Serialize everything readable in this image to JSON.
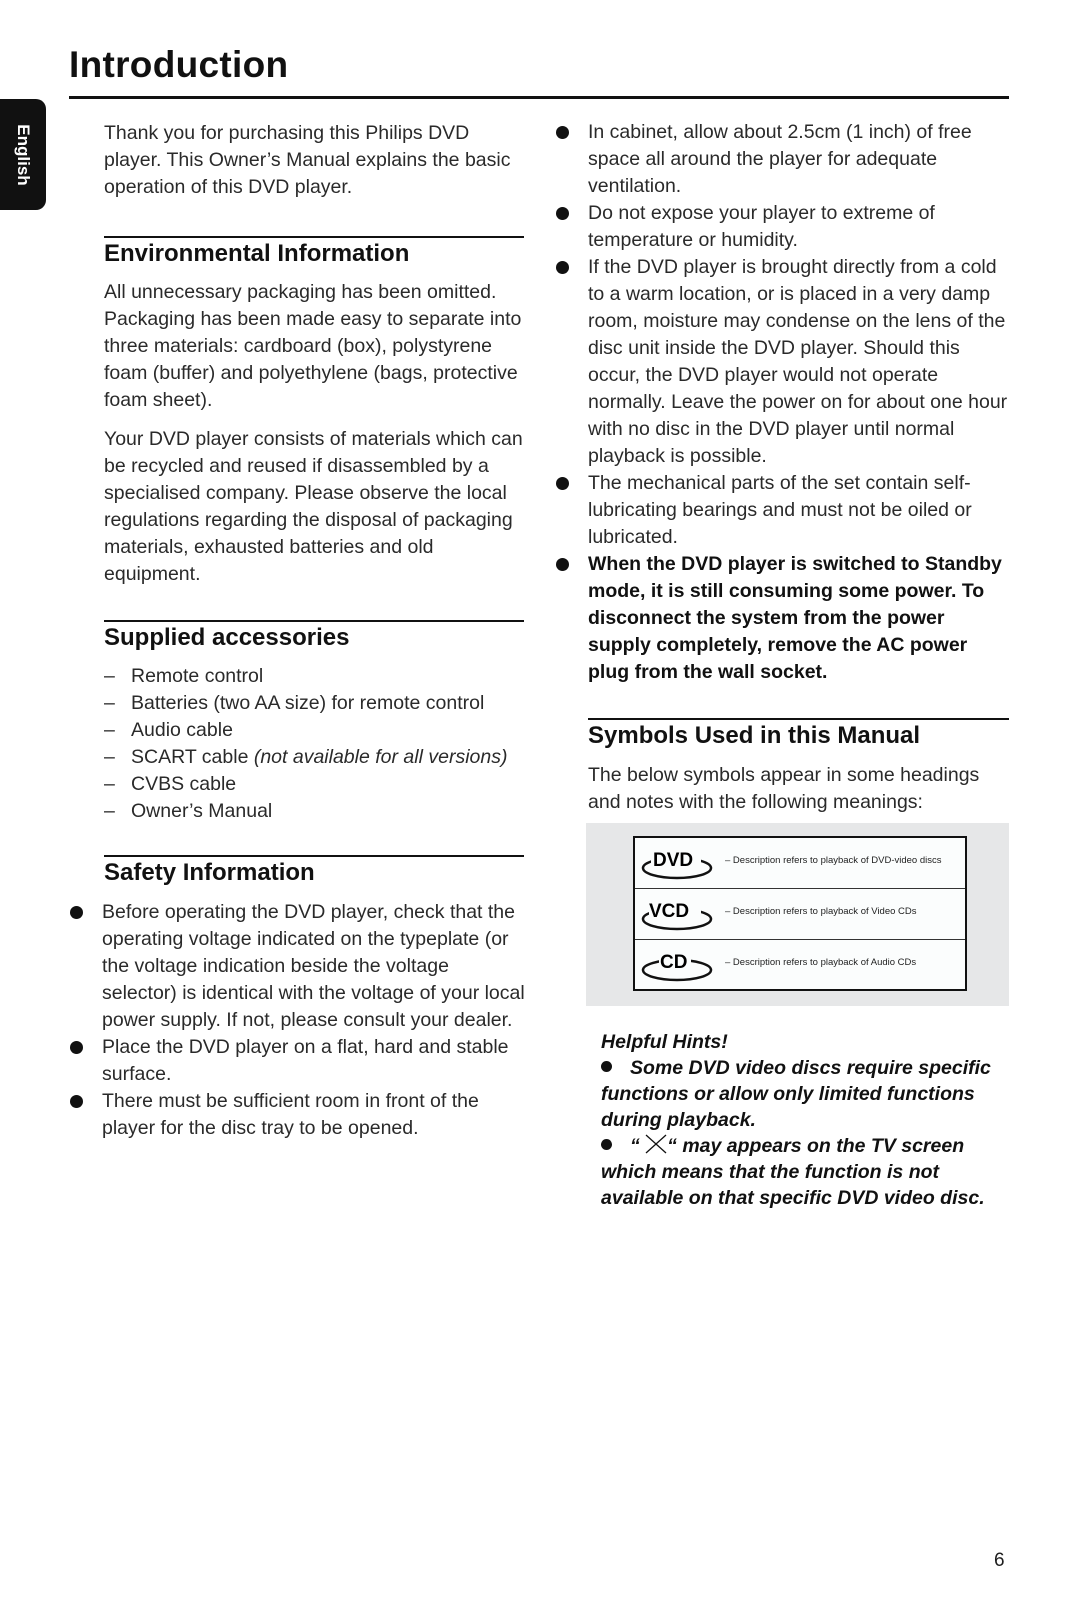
{
  "title": "Introduction",
  "language_tab": "English",
  "intro": "Thank you for purchasing this Philips DVD player. This Owner’s Manual explains the basic operation of this DVD player.",
  "environmental": {
    "heading": "Environmental Information",
    "paragraphs": [
      "All unnecessary packaging has been omitted. Packaging has been made easy to separate into three materials: cardboard (box), polystyrene foam (buffer) and polyethylene (bags, protective foam sheet).",
      "Your DVD player consists of materials which can be recycled and reused if disassembled by a specialised company. Please observe the local regulations regarding the disposal of packaging materials, exhausted batteries and old equipment."
    ]
  },
  "accessories": {
    "heading": "Supplied accessories",
    "items": [
      {
        "text": "Remote control",
        "note": ""
      },
      {
        "text": "Batteries (two AA size) for remote control",
        "note": ""
      },
      {
        "text": "Audio cable",
        "note": ""
      },
      {
        "text": "SCART cable ",
        "note": "(not available for all versions)"
      },
      {
        "text": "CVBS cable",
        "note": ""
      },
      {
        "text": "Owner’s Manual",
        "note": ""
      }
    ]
  },
  "safety": {
    "heading": "Safety Information",
    "bullets": [
      "Before operating the DVD player, check that the operating voltage indicated on the typeplate (or the voltage indication beside the voltage selector) is identical with the voltage of your local power supply. If not, please consult your dealer.",
      "Place the DVD player on a flat, hard and stable surface.",
      "There must be sufficient room in front of the player for the disc tray to be opened."
    ],
    "right_bullets": [
      "In cabinet, allow about 2.5cm (1 inch) of free space all around the player for adequate ventilation.",
      "Do not expose your player to extreme of temperature or humidity.",
      "If the DVD player is brought directly from a cold to a warm location, or is placed in a very damp room, moisture may condense on the lens of the disc unit inside the DVD player. Should this occur, the DVD player would not operate normally. Leave the power on for about one hour with no disc in the DVD player until normal playback is possible.",
      "The mechanical parts of the set contain self-lubricating bearings and must not be oiled or lubricated."
    ],
    "bold_bullet": "When the DVD player is switched to Standby mode, it is still consuming some power. To disconnect the system from the power supply completely, remove the AC power plug from the wall socket."
  },
  "symbols": {
    "heading": "Symbols Used in this Manual",
    "intro": "The below symbols appear in some headings and notes with the following meanings:",
    "rows": [
      {
        "logo": "DVD",
        "desc": "– Description refers to playback of DVD-video discs"
      },
      {
        "logo": "VCD",
        "desc": "– Description refers to playback of Video CDs"
      },
      {
        "logo": "CD",
        "desc": "– Description refers to playback of Audio CDs"
      }
    ]
  },
  "hints": {
    "heading": "Helpful Hints!",
    "items": [
      "Some DVD video discs require specific functions or allow only limited functions during playback.",
      "may appears on the TV screen which means that the function is not available on that specific DVD video disc."
    ],
    "quote_open": "“",
    "quote_close": "“"
  },
  "page_number": "6"
}
